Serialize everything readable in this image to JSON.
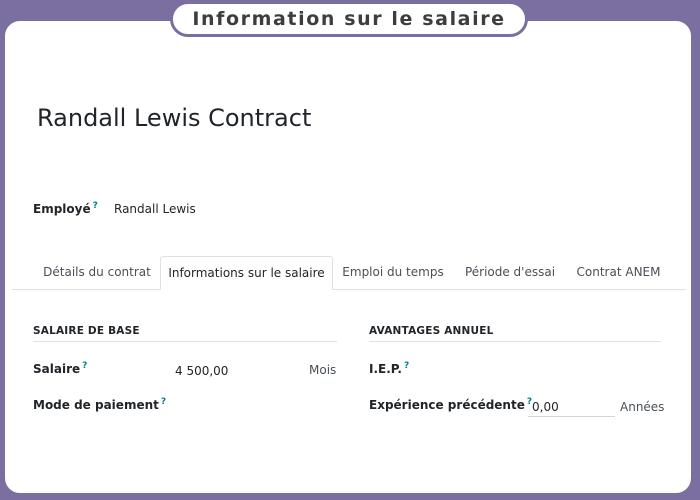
{
  "frame": {
    "title": "Information sur le salaire"
  },
  "record": {
    "title": "Randall Lewis Contract"
  },
  "employee": {
    "label": "Employé",
    "help": "?",
    "value": "Randall Lewis"
  },
  "tabs": [
    {
      "label": "Détails du contrat",
      "active": false
    },
    {
      "label": "Informations sur le salaire",
      "active": true
    },
    {
      "label": "Emploi du temps",
      "active": false
    },
    {
      "label": "Période d'essai",
      "active": false
    },
    {
      "label": "Contrat ANEM",
      "active": false
    }
  ],
  "salary_section": {
    "title": "SALAIRE DE BASE",
    "salary_label": "Salaire",
    "salary_help": "?",
    "salary_value": "4 500,00",
    "salary_unit": "Mois",
    "payment_mode_label": "Mode de paiement",
    "payment_mode_help": "?"
  },
  "benefits_section": {
    "title": "AVANTAGES ANNUEL",
    "iep_label": "I.E.P.",
    "iep_help": "?",
    "experience_label": "Expérience précédente",
    "experience_help": "?",
    "experience_value": "0,00",
    "experience_unit": "Années"
  },
  "colors": {
    "frame_border": "#7a6f9e",
    "help_mark": "#017e84",
    "text": "#212529"
  }
}
